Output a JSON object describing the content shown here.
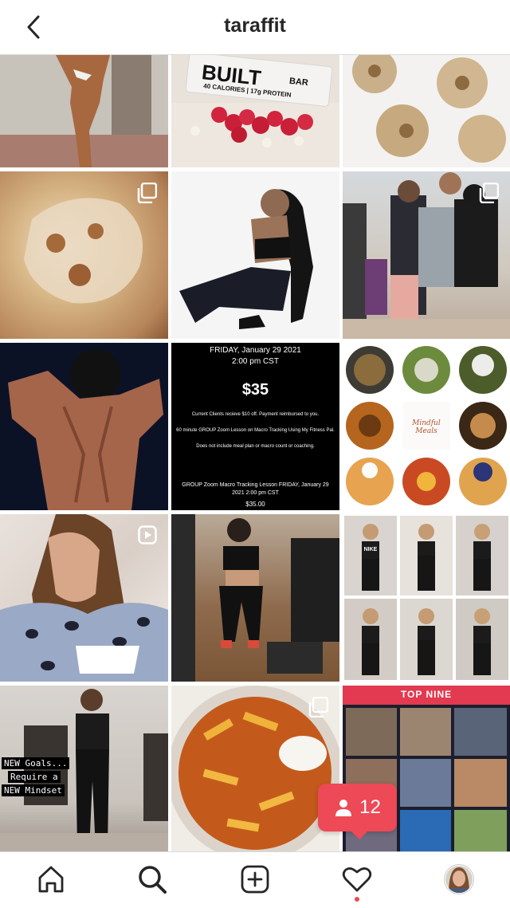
{
  "header": {
    "title": "taraffit"
  },
  "posts": {
    "built_bar": {
      "brand": "BUILT",
      "sub": "BAR",
      "line": "40 CALORIES | 17g PROTEIN"
    },
    "macro": {
      "title_line": "FRIDAY, January 29 2021",
      "time_line": "2:00 pm CST",
      "price": "$35",
      "line1": "Current Clients recieve $10 off. Payment reimbursed to you.",
      "line2": "60 minute GROUP Zoom Lesson on Macro Tracking Using My Fitness Pal.",
      "line3": "Does not include meal plan or macro count or coaching.",
      "caption": "GROUP Zoom Macro Tracking Lesson FRIDAY, January 29 2021 2:00 pm CST",
      "caption_price": "$35.00"
    },
    "meals": {
      "label": "Mindful Meals"
    },
    "goals": {
      "line1": "NEW Goals...",
      "line2": "Require a",
      "line3": "NEW Mindset"
    },
    "nike": {
      "label": "NIKE"
    },
    "topnine": {
      "label": "TOP NINE"
    }
  },
  "notification": {
    "count": "12"
  },
  "colors": {
    "accent": "#ed4956",
    "text": "#262626",
    "border": "#dbdbdb"
  },
  "icons": [
    "back-arrow-icon",
    "home-icon",
    "search-icon",
    "add-post-icon",
    "heart-icon",
    "profile-avatar-icon",
    "carousel-icon",
    "reels-icon",
    "person-icon"
  ]
}
